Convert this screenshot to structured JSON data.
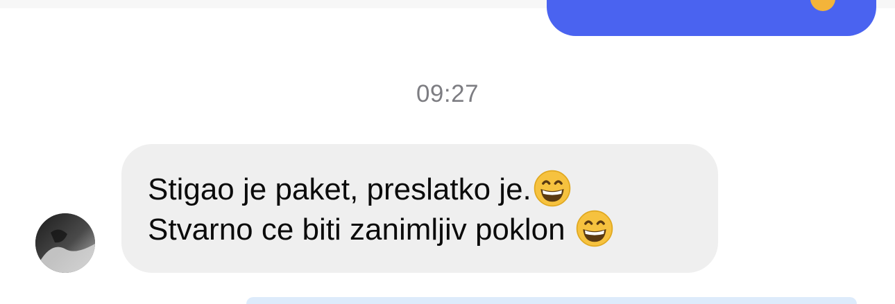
{
  "conversation": {
    "timestamp": "09:27",
    "received_message": {
      "lines": [
        {
          "text": "Stigao je paket, preslatko je.",
          "emoji": "grinning-face-with-smiling-eyes"
        },
        {
          "text": "Stvarno ce biti zanimljiv poklon ",
          "emoji": "grinning-face-with-smiling-eyes"
        }
      ]
    }
  },
  "colors": {
    "sent_bubble": "#4a63f0",
    "received_bubble": "#efefef",
    "timestamp_text": "#7d7d82",
    "message_text": "#0b0b0b",
    "emoji_face": "#f6c23f"
  }
}
